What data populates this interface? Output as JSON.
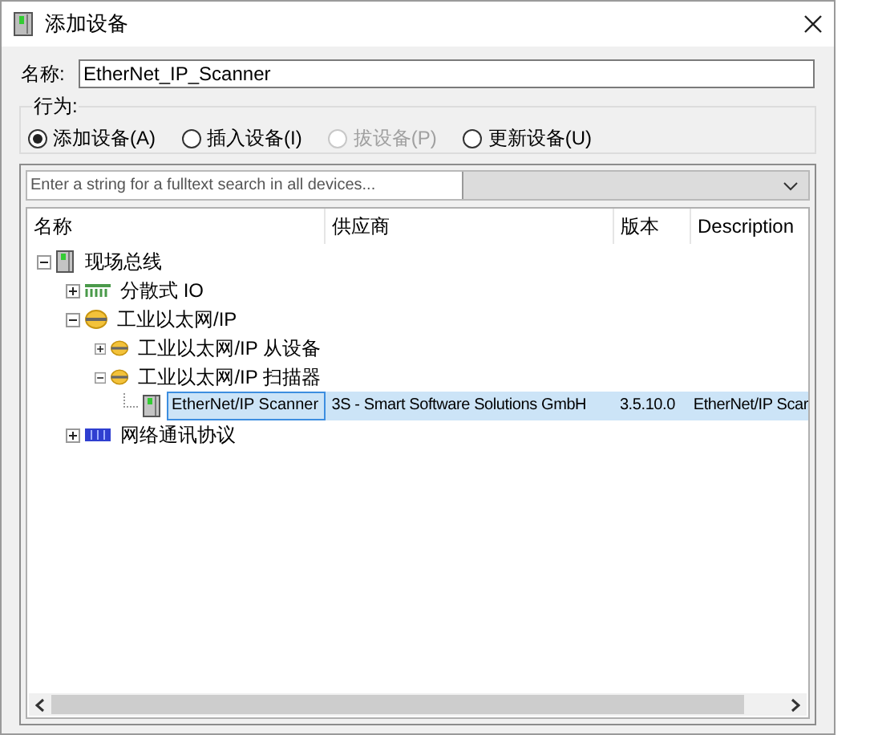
{
  "window": {
    "title": "添加设备"
  },
  "name_field": {
    "label": "名称:",
    "value": "EtherNet_IP_Scanner"
  },
  "action_group": {
    "title": "行为:",
    "options": [
      {
        "label": "添加设备(A)",
        "selected": true,
        "disabled": false
      },
      {
        "label": "插入设备(I)",
        "selected": false,
        "disabled": false
      },
      {
        "label": "拔设备(P)",
        "selected": false,
        "disabled": true
      },
      {
        "label": "更新设备(U)",
        "selected": false,
        "disabled": false
      }
    ]
  },
  "search": {
    "placeholder": "Enter a string for a fulltext search in all devices..."
  },
  "table": {
    "columns": [
      "名称",
      "供应商",
      "版本",
      "Description"
    ],
    "tree": [
      {
        "label": "现场总线",
        "kind": "device",
        "expanded": true,
        "selected": false,
        "children": [
          {
            "label": "分散式 IO",
            "kind": "io",
            "expanded": false,
            "selected": false
          },
          {
            "label": "工业以太网/IP",
            "kind": "ethernet",
            "expanded": true,
            "selected": false,
            "children": [
              {
                "label": "工业以太网/IP 从设备",
                "kind": "ethernet",
                "expanded": false,
                "selected": false
              },
              {
                "label": "工业以太网/IP 扫描器",
                "kind": "ethernet",
                "expanded": true,
                "selected": false,
                "children": [
                  {
                    "label": "EtherNet/IP Scanner",
                    "kind": "device",
                    "selected": true,
                    "vendor": "3S - Smart Software Solutions GmbH",
                    "version": "3.5.10.0",
                    "description": "EtherNet/IP Scar"
                  }
                ]
              }
            ]
          },
          {
            "label": "网络通讯协议",
            "kind": "network",
            "expanded": false,
            "selected": false
          }
        ]
      }
    ]
  }
}
